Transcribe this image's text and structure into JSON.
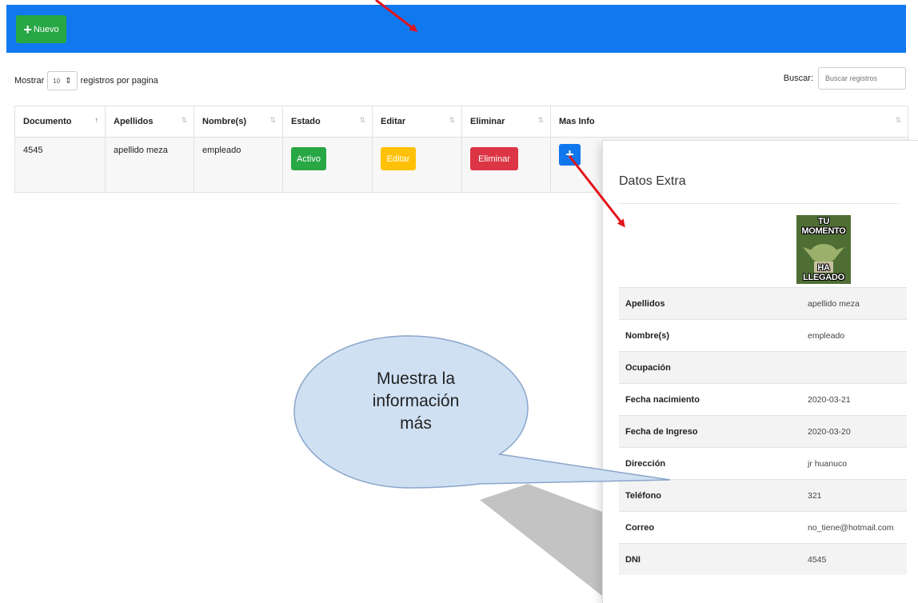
{
  "toolbar": {
    "new_label": "Nuevo"
  },
  "controls": {
    "show_label": "Mostrar",
    "page_size": "10",
    "per_page_label": "registros por pagina",
    "search_label": "Buscar:",
    "search_placeholder": "Buscar registros"
  },
  "table": {
    "headers": [
      "Documento",
      "Apellidos",
      "Nombre(s)",
      "Estado",
      "Editar",
      "Eliminar",
      "Mas Info"
    ],
    "rows": [
      {
        "documento": "4545",
        "apellidos": "apellido meza",
        "nombre": "empleado",
        "estado": "Activo",
        "editar": "Editar",
        "eliminar": "Eliminar"
      }
    ]
  },
  "modal": {
    "title": "Datos Extra",
    "image_text_top": "TU MOMENTO",
    "image_text_bottom": "HA LLEGADO",
    "fields": [
      {
        "label": "Apellidos",
        "value": "apellido meza"
      },
      {
        "label": "Nombre(s)",
        "value": "empleado"
      },
      {
        "label": "Ocupación",
        "value": ""
      },
      {
        "label": "Fecha nacimiento",
        "value": "2020-03-21"
      },
      {
        "label": "Fecha de Ingreso",
        "value": "2020-03-20"
      },
      {
        "label": "Dirección",
        "value": "jr huanuco"
      },
      {
        "label": "Teléfono",
        "value": "321"
      },
      {
        "label": "Correo",
        "value": "no_tiene@hotmail.com"
      },
      {
        "label": "DNI",
        "value": "4545"
      }
    ]
  },
  "callout": {
    "line1": "Muestra la",
    "line2": "información",
    "line3": "más"
  },
  "colors": {
    "topbar": "#1179f0",
    "success": "#28a745",
    "warning": "#ffc107",
    "danger": "#dc3545",
    "primary": "#1177ee",
    "arrow": "#e3141b"
  }
}
